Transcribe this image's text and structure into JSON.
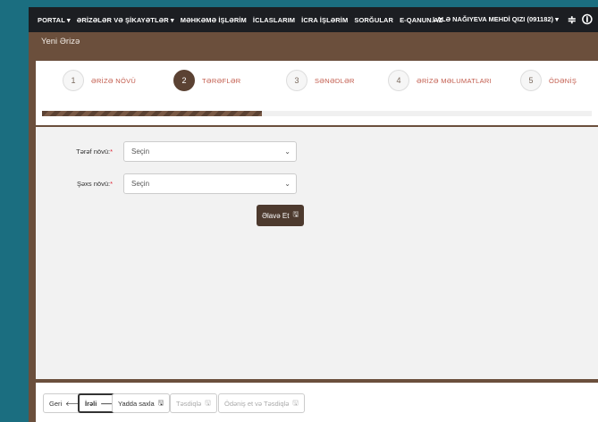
{
  "topnav": {
    "items": [
      "PORTAL ▾",
      "ƏRİZƏLƏR VƏ ŞİKAYƏTLƏR ▾",
      "MƏHKƏMƏ İŞLƏRİM",
      "İCLASLARIM",
      "İCRA İŞLƏRİM",
      "SORĞULAR",
      "E-QANUN.AZ"
    ],
    "user": "LALƏ NAĞIYEVA MEHDİ QIZI (091182) ▾",
    "settings_icon": "≑",
    "info_icon": "🛈"
  },
  "page": {
    "title": "Yeni Ərizə"
  },
  "steps": [
    {
      "num": "1",
      "label": "ƏRİZƏ NÖVÜ"
    },
    {
      "num": "2",
      "label": "TƏRƏFLƏR"
    },
    {
      "num": "3",
      "label": "SƏNƏDLƏR"
    },
    {
      "num": "4",
      "label": "ƏRİZƏ MƏLUMATLARI"
    },
    {
      "num": "5",
      "label": "ÖDƏNİŞ"
    }
  ],
  "progress": 0.4,
  "form": {
    "side_type": {
      "label": "Tərəf növü:",
      "value": "Seçin"
    },
    "person_type": {
      "label": "Şəxs növü:",
      "value": "Seçin"
    },
    "add_button": "Əlavə Et"
  },
  "bottom": {
    "back": "Geri",
    "next": "İrəli",
    "save_draft": "Yadda saxla",
    "confirm": "Təsdiqlə",
    "pay_confirm": "Ödəniş et və Təsdiqlə"
  }
}
